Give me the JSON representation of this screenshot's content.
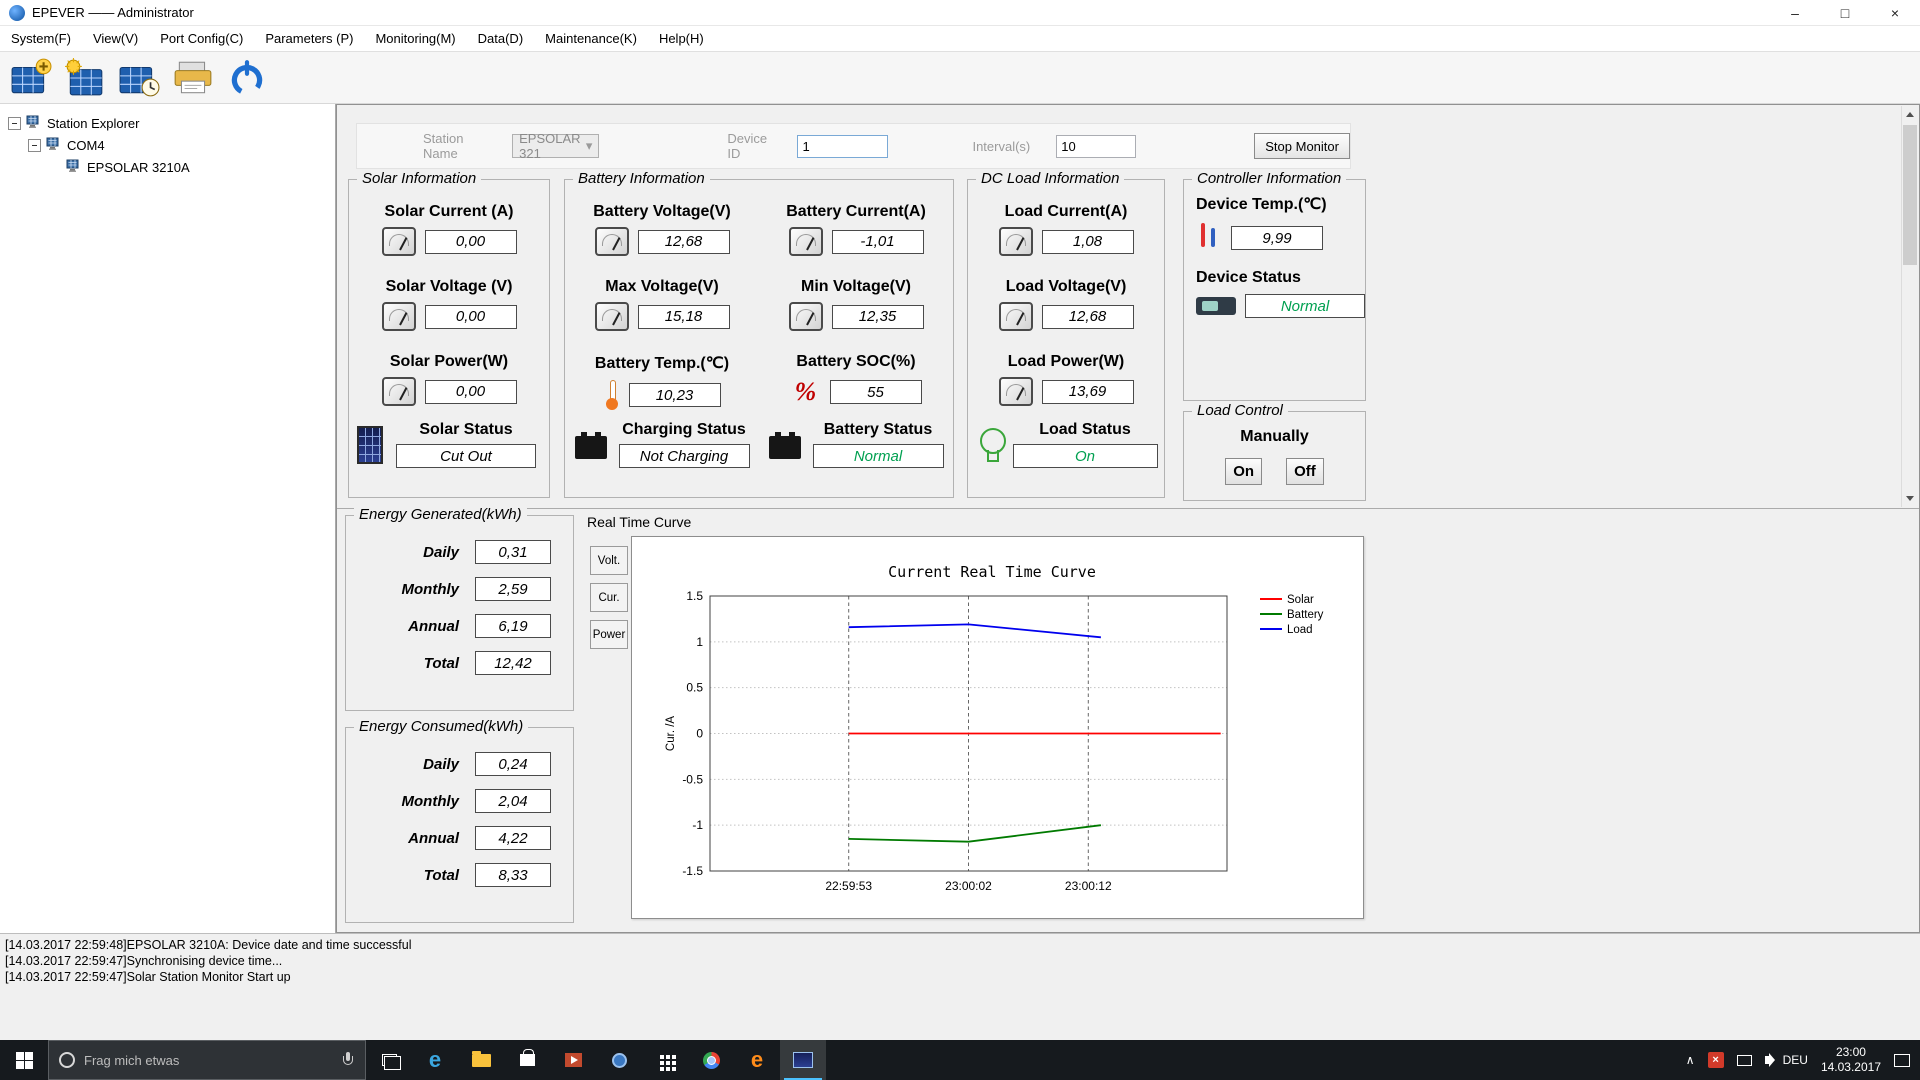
{
  "colors": {
    "status_ok_green": "#00a050",
    "series_solar": "#ff0000",
    "series_battery": "#007a00",
    "series_load": "#0000ee",
    "taskbar_bg": "#161a1e"
  },
  "window": {
    "title": "EPEVER —— Administrator"
  },
  "menu": {
    "items": [
      {
        "label": "System(F)"
      },
      {
        "label": "View(V)"
      },
      {
        "label": "Port Config(C)"
      },
      {
        "label": "Parameters (P)"
      },
      {
        "label": "Monitoring(M)"
      },
      {
        "label": "Data(D)"
      },
      {
        "label": "Maintenance(K)"
      },
      {
        "label": "Help(H)"
      }
    ]
  },
  "toolbar": {
    "icons": [
      {
        "name": "add-station"
      },
      {
        "name": "station-settings"
      },
      {
        "name": "station-clock"
      },
      {
        "name": "print-device"
      },
      {
        "name": "power"
      }
    ]
  },
  "tree": {
    "root": "Station Explorer",
    "port": "COM4",
    "device": "EPSOLAR 3210A"
  },
  "monitor_bar": {
    "station_name_label": "Station Name",
    "station_name_value": "EPSOLAR 321",
    "device_id_label": "Device ID",
    "device_id_value": "1",
    "interval_label": "Interval(s)",
    "interval_value": "10",
    "stop_button": "Stop Monitor"
  },
  "solar": {
    "title": "Solar Information",
    "metrics": [
      {
        "label": "Solar Current (A)",
        "value": "0,00"
      },
      {
        "label": "Solar Voltage (V)",
        "value": "0,00"
      },
      {
        "label": "Solar Power(W)",
        "value": "0,00"
      }
    ],
    "status_label": "Solar Status",
    "status_value": "Cut Out"
  },
  "battery": {
    "title": "Battery Information",
    "metrics": [
      {
        "label": "Battery Voltage(V)",
        "value": "12,68"
      },
      {
        "label": "Battery Current(A)",
        "value": "-1,01"
      },
      {
        "label": "Max Voltage(V)",
        "value": "15,18"
      },
      {
        "label": "Min Voltage(V)",
        "value": "12,35"
      },
      {
        "label": "Battery Temp.(℃)",
        "value": "10,23"
      },
      {
        "label": "Battery SOC(%)",
        "value": "55"
      }
    ],
    "charging_status_label": "Charging Status",
    "charging_status_value": "Not Charging",
    "battery_status_label": "Battery Status",
    "battery_status_value": "Normal"
  },
  "dc_load": {
    "title": "DC Load Information",
    "metrics": [
      {
        "label": "Load Current(A)",
        "value": "1,08"
      },
      {
        "label": "Load Voltage(V)",
        "value": "12,68"
      },
      {
        "label": "Load Power(W)",
        "value": "13,69"
      }
    ],
    "status_label": "Load Status",
    "status_value": "On"
  },
  "controller": {
    "title": "Controller Information",
    "temp_label": "Device Temp.(℃)",
    "temp_value": "9,99",
    "status_label": "Device Status",
    "status_value": "Normal"
  },
  "load_control": {
    "title": "Load Control",
    "manually_label": "Manually",
    "on_button": "On",
    "off_button": "Off"
  },
  "energy_generated": {
    "title": "Energy Generated(kWh)",
    "rows": [
      {
        "label": "Daily",
        "value": "0,31"
      },
      {
        "label": "Monthly",
        "value": "2,59"
      },
      {
        "label": "Annual",
        "value": "6,19"
      },
      {
        "label": "Total",
        "value": "12,42"
      }
    ]
  },
  "energy_consumed": {
    "title": "Energy Consumed(kWh)",
    "rows": [
      {
        "label": "Daily",
        "value": "0,24"
      },
      {
        "label": "Monthly",
        "value": "2,04"
      },
      {
        "label": "Annual",
        "value": "4,22"
      },
      {
        "label": "Total",
        "value": "8,33"
      }
    ]
  },
  "realtime": {
    "panel_title": "Real Time Curve",
    "tabs": [
      {
        "label": "Volt."
      },
      {
        "label": "Cur."
      },
      {
        "label": "Power"
      }
    ]
  },
  "chart_data": {
    "type": "line",
    "title": "Current Real Time Curve",
    "xlabel": "",
    "ylabel": "Cur. /A",
    "ylim": [
      -1.5,
      1.5
    ],
    "yticks": [
      "1.5",
      "1",
      "0.5",
      "0",
      "-0.5",
      "-1",
      "-1.5"
    ],
    "x_domain": [
      -11,
      30
    ],
    "grid": true,
    "legend_position": "top-right",
    "xticks": [
      {
        "t": 0,
        "label": "22:59:53"
      },
      {
        "t": 9.5,
        "label": "23:00:02"
      },
      {
        "t": 19,
        "label": "23:00:12"
      }
    ],
    "series": [
      {
        "name": "Solar",
        "color": "#ff0000",
        "points": [
          [
            0,
            0
          ],
          [
            9.5,
            0
          ],
          [
            19,
            0
          ],
          [
            29.5,
            0
          ]
        ]
      },
      {
        "name": "Battery",
        "color": "#007a00",
        "points": [
          [
            0,
            -1.15
          ],
          [
            9.5,
            -1.18
          ],
          [
            20,
            -1.0
          ]
        ]
      },
      {
        "name": "Load",
        "color": "#0000ee",
        "points": [
          [
            0,
            1.16
          ],
          [
            9.5,
            1.19
          ],
          [
            20,
            1.05
          ]
        ]
      }
    ]
  },
  "log": {
    "lines": [
      "[14.03.2017 22:59:48]EPSOLAR 3210A: Device date and time successful",
      "[14.03.2017 22:59:47]Synchronising device time...",
      "[14.03.2017 22:59:47]Solar Station Monitor Start up"
    ]
  },
  "taskbar": {
    "search_placeholder": "Frag mich etwas",
    "language": "DEU",
    "time": "23:00",
    "date": "14.03.2017"
  }
}
